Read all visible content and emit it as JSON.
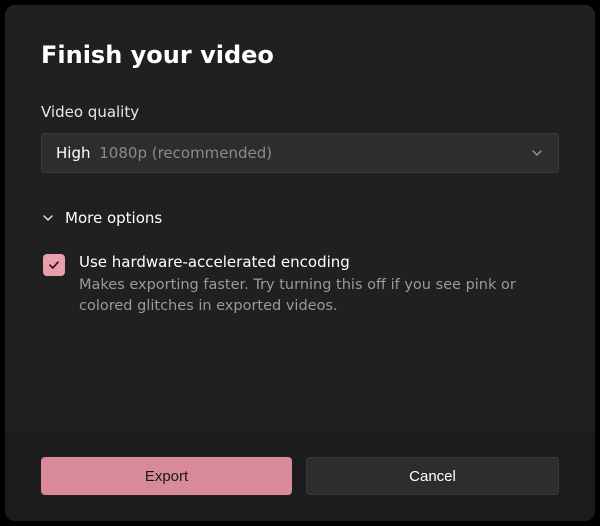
{
  "dialog": {
    "title": "Finish your video"
  },
  "quality": {
    "label": "Video quality",
    "selected_strong": "High",
    "selected_sub": "1080p (recommended)"
  },
  "more": {
    "label": "More options"
  },
  "hw": {
    "checked": true,
    "label": "Use hardware-accelerated encoding",
    "description": "Makes exporting faster. Try turning this off if you see pink or colored glitches in exported videos."
  },
  "actions": {
    "export": "Export",
    "cancel": "Cancel"
  },
  "colors": {
    "accent": "#d88a9a",
    "checkbox": "#e8a0ac"
  }
}
